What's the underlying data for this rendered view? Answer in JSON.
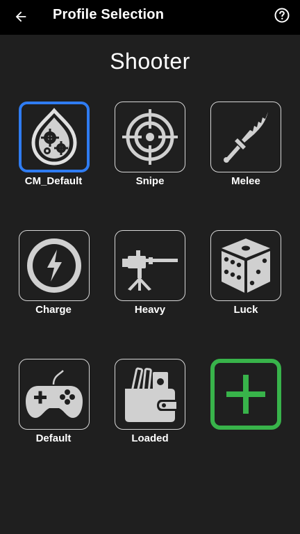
{
  "appbar": {
    "title": "Profile Selection",
    "back_icon": "arrow-left-icon",
    "help_icon": "question-circle-icon"
  },
  "category": "Shooter",
  "colors": {
    "background": "#1f1f1f",
    "appbar": "#000000",
    "selected_border": "#2f7cf2",
    "add_accent": "#38b34a",
    "icon_fill": "#d0d0d0"
  },
  "profiles": [
    {
      "label": "CM_Default",
      "icon": "gears-drop-icon",
      "selected": true
    },
    {
      "label": "Snipe",
      "icon": "crosshair-icon",
      "selected": false
    },
    {
      "label": "Melee",
      "icon": "knife-icon",
      "selected": false
    },
    {
      "label": "Charge",
      "icon": "lightning-icon",
      "selected": false
    },
    {
      "label": "Heavy",
      "icon": "machine-gun-icon",
      "selected": false
    },
    {
      "label": "Luck",
      "icon": "dice-icon",
      "selected": false
    },
    {
      "label": "Default",
      "icon": "gamepad-icon",
      "selected": false
    },
    {
      "label": "Loaded",
      "icon": "wallet-icon",
      "selected": false
    }
  ],
  "add_tile": {
    "icon": "plus-icon"
  }
}
